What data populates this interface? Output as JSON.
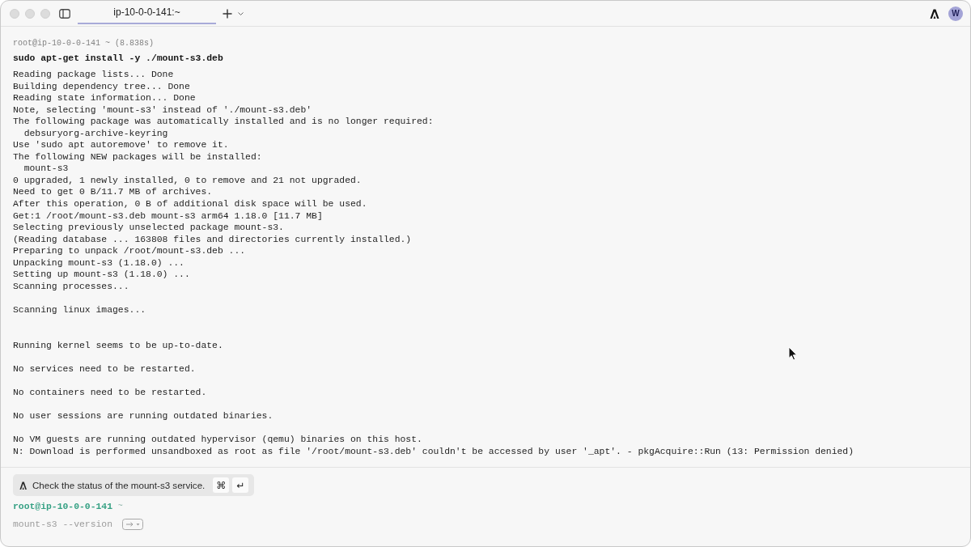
{
  "tabs": [
    {
      "label": "ip-10-0-0-141:~",
      "selected": true
    }
  ],
  "account": {
    "initial": "W"
  },
  "block": {
    "header": "root@ip-10-0-0-141 ~ (8.838s)",
    "command": "sudo apt-get install -y ./mount-s3.deb",
    "output": [
      {
        "kind": "text",
        "text": "Reading package lists... Done"
      },
      {
        "kind": "text",
        "text": "Building dependency tree... Done"
      },
      {
        "kind": "text",
        "text": "Reading state information... Done"
      },
      {
        "kind": "text",
        "text": "Note, selecting 'mount-s3' instead of './mount-s3.deb'"
      },
      {
        "kind": "text",
        "text": "The following package was automatically installed and is no longer required:"
      },
      {
        "kind": "text",
        "text": "  debsuryorg-archive-keyring"
      },
      {
        "kind": "text",
        "text": "Use 'sudo apt autoremove' to remove it."
      },
      {
        "kind": "text",
        "text": "The following NEW packages will be installed:"
      },
      {
        "kind": "text",
        "text": "  mount-s3"
      },
      {
        "kind": "text",
        "text": "0 upgraded, 1 newly installed, 0 to remove and 21 not upgraded."
      },
      {
        "kind": "text",
        "text": "Need to get 0 B/11.7 MB of archives."
      },
      {
        "kind": "text",
        "text": "After this operation, 0 B of additional disk space will be used."
      },
      {
        "kind": "text",
        "text": "Get:1 /root/mount-s3.deb mount-s3 arm64 1.18.0 [11.7 MB]"
      },
      {
        "kind": "text",
        "text": "Selecting previously unselected package mount-s3."
      },
      {
        "kind": "text",
        "text": "(Reading database ... 163808 files and directories currently installed.)"
      },
      {
        "kind": "text",
        "text": "Preparing to unpack /root/mount-s3.deb ..."
      },
      {
        "kind": "text",
        "text": "Unpacking mount-s3 (1.18.0) ..."
      },
      {
        "kind": "text",
        "text": "Setting up mount-s3 (1.18.0) ..."
      },
      {
        "kind": "text",
        "text": "Scanning processes..."
      },
      {
        "kind": "blank"
      },
      {
        "kind": "text",
        "text": "Scanning linux images..."
      },
      {
        "kind": "blank"
      },
      {
        "kind": "blank"
      },
      {
        "kind": "text",
        "text": "Running kernel seems to be up-to-date."
      },
      {
        "kind": "blank"
      },
      {
        "kind": "text",
        "text": "No services need to be restarted."
      },
      {
        "kind": "blank"
      },
      {
        "kind": "text",
        "text": "No containers need to be restarted."
      },
      {
        "kind": "blank"
      },
      {
        "kind": "text",
        "text": "No user sessions are running outdated binaries."
      },
      {
        "kind": "blank"
      },
      {
        "kind": "text",
        "text": "No VM guests are running outdated hypervisor (qemu) binaries on this host."
      },
      {
        "kind": "text",
        "text": "N: Download is performed unsandboxed as root as file '/root/mount-s3.deb' couldn't be accessed by user '_apt'. - pkgAcquire::Run (13: Permission denied)"
      }
    ]
  },
  "suggestion_chip": {
    "text": "Check the status of the mount-s3 service.",
    "keys": [
      "⌘",
      "↵"
    ]
  },
  "prompt": {
    "host": "root@ip-10-0-0-141",
    "path": "~"
  },
  "input": {
    "placeholder": "mount-s3 --version"
  }
}
